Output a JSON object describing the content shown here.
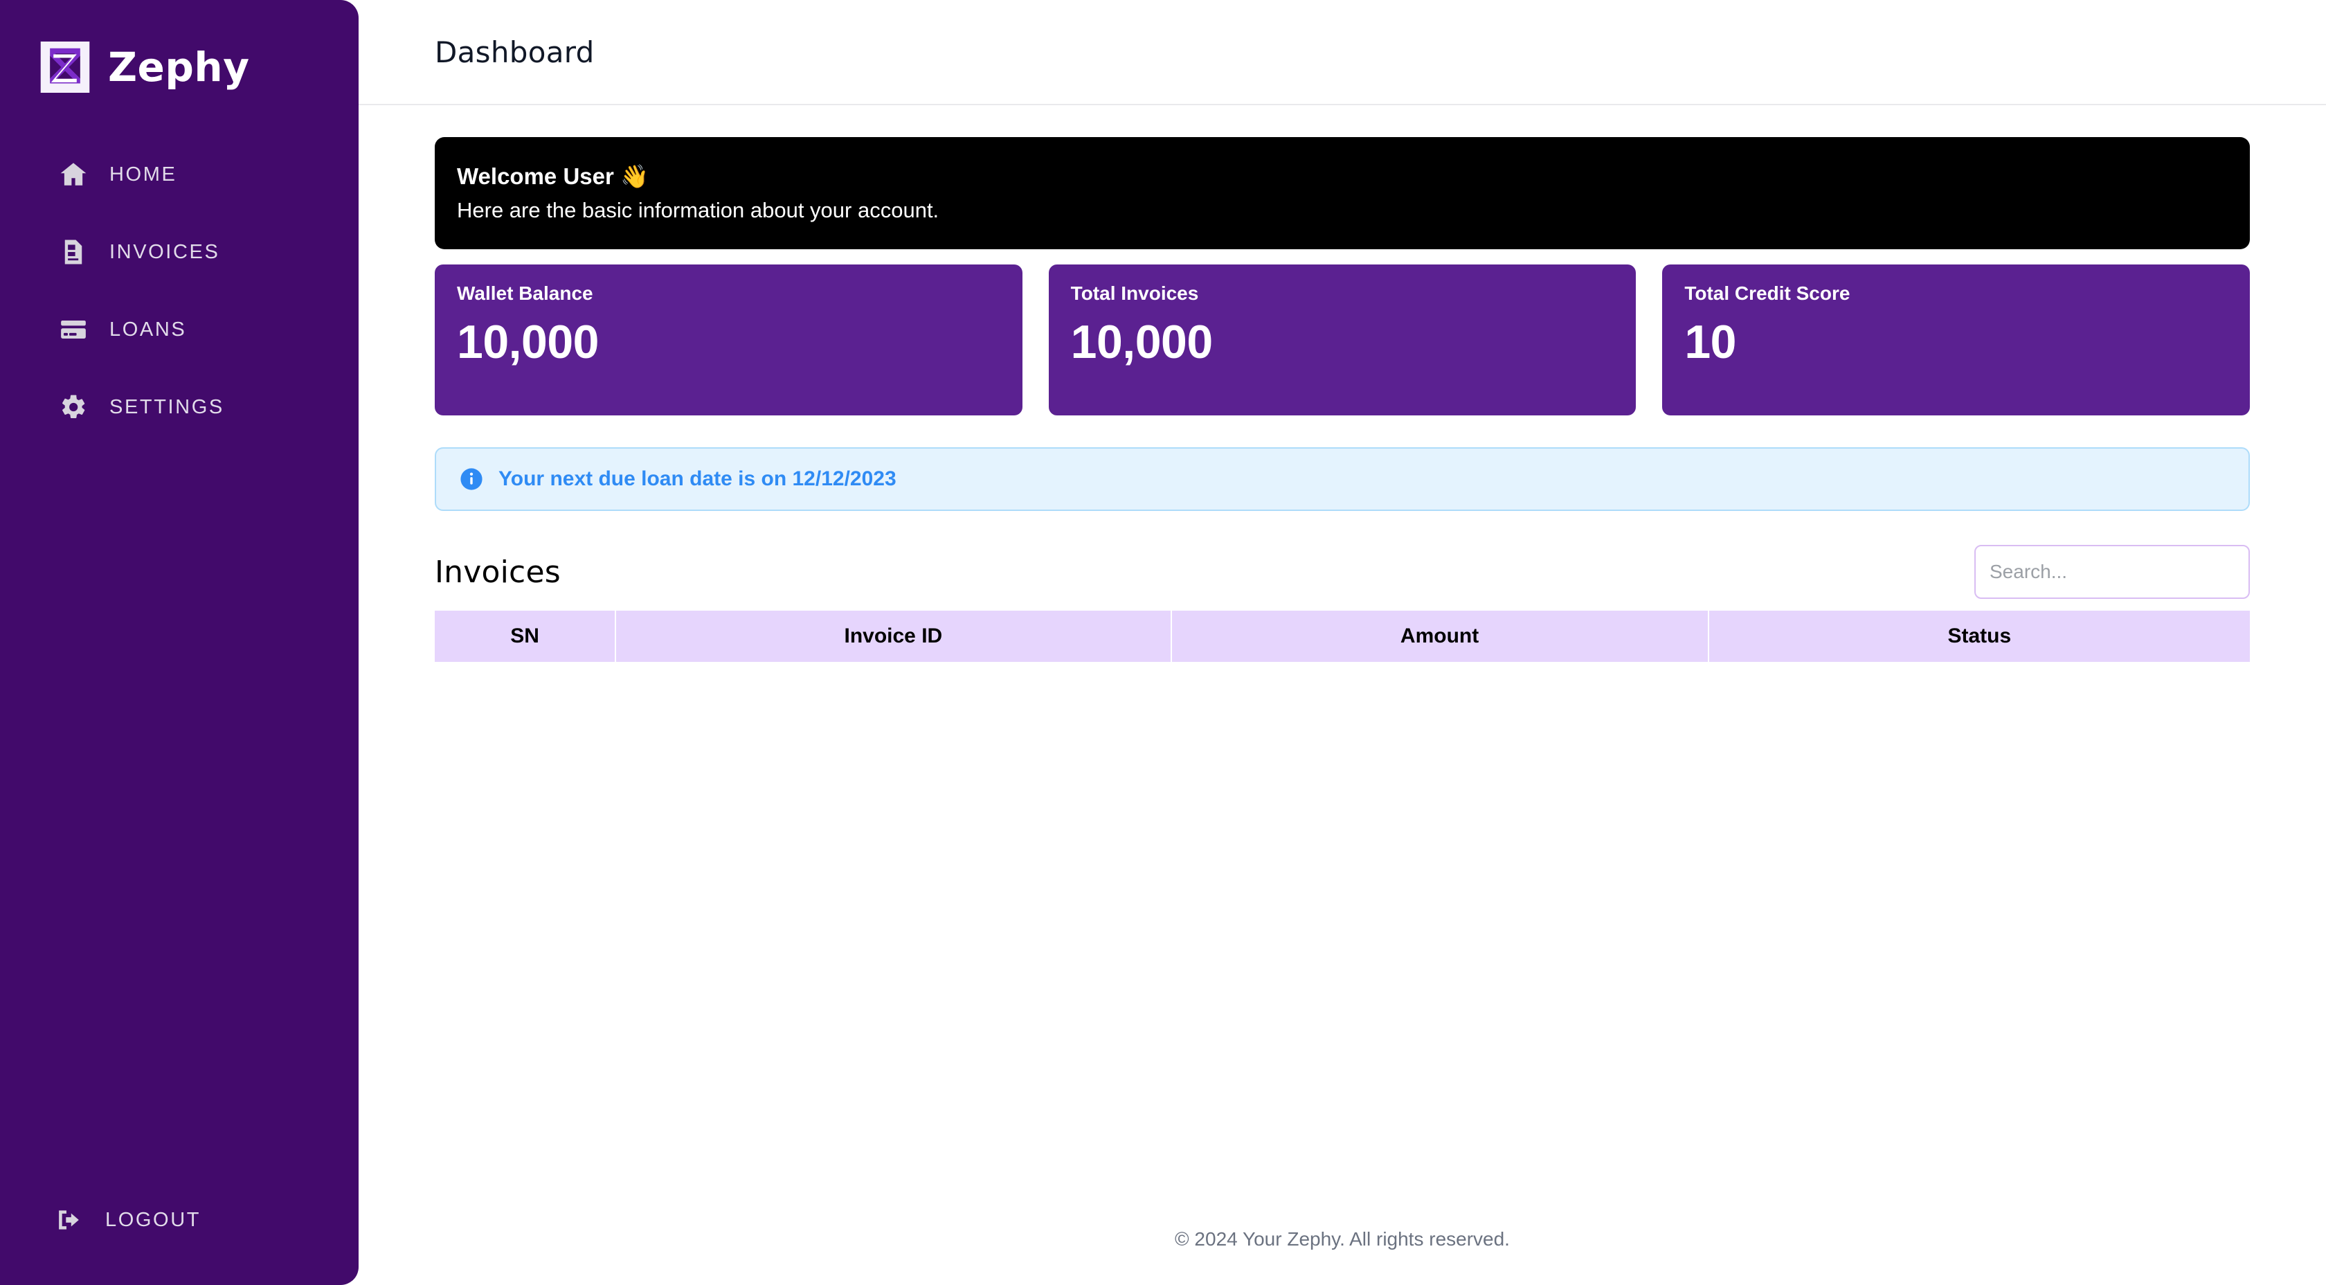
{
  "sidebar": {
    "brand": {
      "name": "Zephy",
      "logo_icon": "zephy-z-logo"
    },
    "items": [
      {
        "label": "HOME",
        "icon": "home-icon"
      },
      {
        "label": "INVOICES",
        "icon": "document-icon"
      },
      {
        "label": "LOANS",
        "icon": "credit-card-icon"
      },
      {
        "label": "SETTINGS",
        "icon": "gear-icon"
      }
    ],
    "logout": {
      "label": "LOGOUT",
      "icon": "logout-icon"
    },
    "colors": {
      "background": "#420A6B",
      "label": "#E2DCEA",
      "icon": "#D8D4DE"
    }
  },
  "topbar": {
    "title": "Dashboard"
  },
  "welcome": {
    "title": "Welcome User 👋",
    "subtitle": "Here are the basic information about your account.",
    "background": "#000000"
  },
  "cards": [
    {
      "label": "Wallet Balance",
      "value": "10,000"
    },
    {
      "label": "Total Invoices",
      "value": "10,000"
    },
    {
      "label": "Total Credit Score",
      "value": "10"
    }
  ],
  "card_colors": {
    "background": "#5B2191",
    "text": "#FFFFFF"
  },
  "alert": {
    "icon": "info-circle-icon",
    "text": "Your next due loan date is on 12/12/2023",
    "background": "#E4F3FE",
    "border": "#AEDCFA",
    "text_color": "#2F8BF4"
  },
  "invoices": {
    "title": "Invoices",
    "search": {
      "value": "",
      "placeholder": "Search..."
    },
    "columns": [
      "SN",
      "Invoice ID",
      "Amount",
      "Status"
    ],
    "rows": [],
    "header_background": "#E6D5FD"
  },
  "footer": {
    "text": "© 2024 Your Zephy. All rights reserved."
  }
}
